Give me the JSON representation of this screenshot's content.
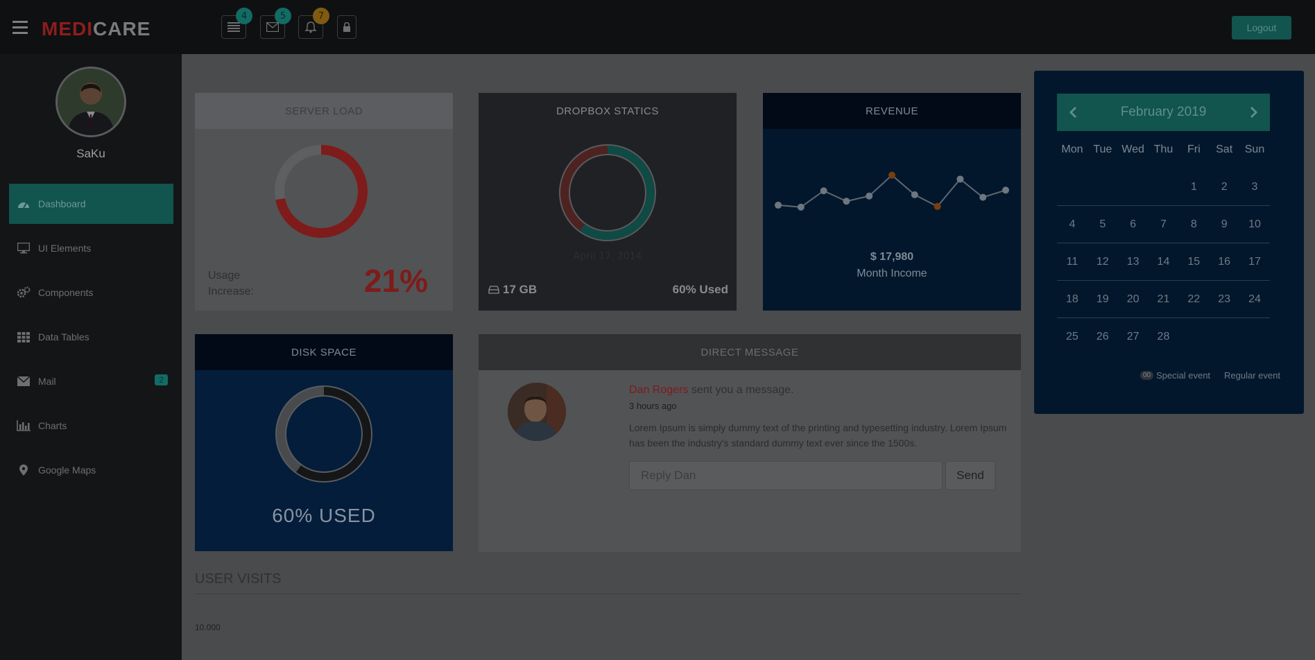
{
  "brand": {
    "part1": "MEDI",
    "part2": "CARE"
  },
  "top_icons": [
    {
      "icon": "list-icon",
      "badge": "4"
    },
    {
      "icon": "envelope-icon",
      "badge": "5"
    },
    {
      "icon": "bell-icon",
      "badge": "7"
    },
    {
      "icon": "lock-icon"
    }
  ],
  "logout_label": "Logout",
  "user": {
    "name": "SaKu"
  },
  "sidebar": {
    "items": [
      {
        "label": "Dashboard",
        "icon": "dashboard-icon"
      },
      {
        "label": "UI Elements",
        "icon": "monitor-icon"
      },
      {
        "label": "Components",
        "icon": "gears-icon"
      },
      {
        "label": "Data Tables",
        "icon": "grid-icon"
      },
      {
        "label": "Mail",
        "icon": "envelope-icon",
        "badge": "2"
      },
      {
        "label": "Charts",
        "icon": "bar-chart-icon"
      },
      {
        "label": "Google Maps",
        "icon": "map-marker-icon"
      }
    ]
  },
  "server_load": {
    "title": "SERVER LOAD",
    "usage_label": "Usage Increase:",
    "usage_value": "21%",
    "donut_fraction": 0.72
  },
  "dropbox": {
    "title": "DROPBOX STATICS",
    "date": "April 17, 2014",
    "size": "17 GB",
    "used": "60% Used",
    "used_fraction": 0.6
  },
  "revenue": {
    "title": "REVENUE",
    "value": "$ 17,980",
    "label": "Month Income",
    "sparkline": [
      32,
      29,
      54,
      38,
      46,
      78,
      48,
      30,
      72,
      44,
      55
    ],
    "highlight_points": [
      5,
      7
    ]
  },
  "disk_space": {
    "title": "DISK SPACE",
    "used_text": "60% USED",
    "used_fraction": 0.6
  },
  "direct_message": {
    "title": "DIRECT MESSAGE",
    "sender": "Dan Rogers",
    "text": " sent you a message.",
    "time": "3 hours ago",
    "body": "Lorem Ipsum is simply dummy text of the printing and typesetting industry. Lorem Ipsum has been the industry's standard dummy text ever since the 1500s.",
    "reply_placeholder": "Reply Dan",
    "send_label": "Send"
  },
  "user_visits": {
    "title": "USER VISITS",
    "first_tick": "10.000"
  },
  "calendar": {
    "month": "February 2019",
    "days": [
      "Mon",
      "Tue",
      "Wed",
      "Thu",
      "Fri",
      "Sat",
      "Sun"
    ],
    "weeks": [
      [
        "",
        "",
        "",
        "",
        "1",
        "2",
        "3"
      ],
      [
        "4",
        "5",
        "6",
        "7",
        "8",
        "9",
        "10"
      ],
      [
        "11",
        "12",
        "13",
        "14",
        "15",
        "16",
        "17"
      ],
      [
        "18",
        "19",
        "20",
        "21",
        "22",
        "23",
        "24"
      ],
      [
        "25",
        "26",
        "27",
        "28",
        "",
        "",
        ""
      ]
    ],
    "legend_swatch": "00",
    "special_label": "Special event",
    "regular_label": "Regular event"
  },
  "colors": {
    "accent": "#12544e",
    "danger": "#7e1b1b",
    "navy": "#03172c"
  }
}
